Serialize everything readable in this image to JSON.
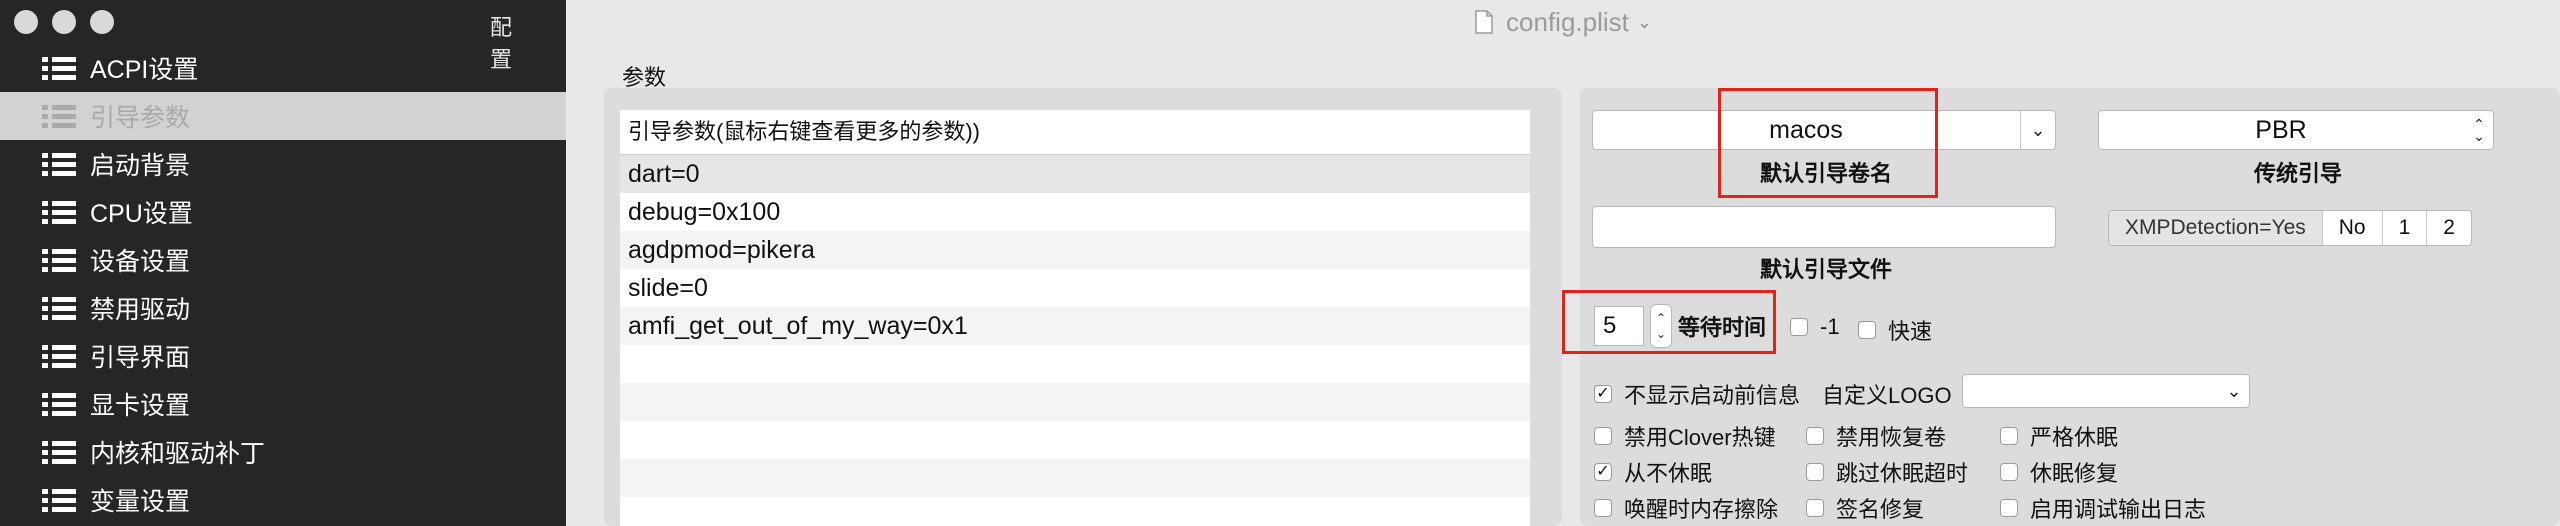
{
  "window": {
    "title": "config.plist"
  },
  "sidebar": {
    "header": "配 置",
    "items": [
      {
        "label": "ACPI设置"
      },
      {
        "label": "引导参数"
      },
      {
        "label": "启动背景"
      },
      {
        "label": "CPU设置"
      },
      {
        "label": "设备设置"
      },
      {
        "label": "禁用驱动"
      },
      {
        "label": "引导界面"
      },
      {
        "label": "显卡设置"
      },
      {
        "label": "内核和驱动补丁"
      },
      {
        "label": "变量设置"
      }
    ],
    "selected_index": 1
  },
  "main": {
    "section_title": "参数",
    "args_table": {
      "header": "引导参数(鼠标右键查看更多的参数))",
      "rows": [
        "dart=0",
        "debug=0x100",
        "agdpmod=pikera",
        "slide=0",
        "amfi_get_out_of_my_way=0x1"
      ]
    },
    "default_volume": {
      "value": "macos",
      "label": "默认引导卷名"
    },
    "legacy": {
      "value": "PBR",
      "label": "传统引导"
    },
    "default_loader": {
      "value": "",
      "label": "默认引导文件"
    },
    "xmp": {
      "options": [
        "XMPDetection=Yes",
        "No",
        "1",
        "2"
      ]
    },
    "timeout": {
      "value": "5",
      "label": "等待时间"
    },
    "checks": {
      "minus1": {
        "label": "-1",
        "checked": false
      },
      "fast": {
        "label": "快速",
        "checked": false
      },
      "no_early": {
        "label": "不显示启动前信息",
        "checked": true
      },
      "disable_hotkeys": {
        "label": "禁用Clover热键",
        "checked": false
      },
      "disable_recovery": {
        "label": "禁用恢复卷",
        "checked": false
      },
      "strict_hibernate": {
        "label": "严格休眠",
        "checked": false
      },
      "never_hibernate": {
        "label": "从不休眠",
        "checked": true
      },
      "skip_hib_timeout": {
        "label": "跳过休眠超时",
        "checked": false
      },
      "hib_fix": {
        "label": "休眠修复",
        "checked": false
      },
      "wake_erase": {
        "label": "唤醒时内存擦除",
        "checked": false
      },
      "sign_fix": {
        "label": "签名修复",
        "checked": false
      },
      "debug_log": {
        "label": "启用调试输出日志",
        "checked": false
      }
    },
    "custom_logo": {
      "label": "自定义LOGO",
      "value": ""
    },
    "check_mark": "✓"
  }
}
